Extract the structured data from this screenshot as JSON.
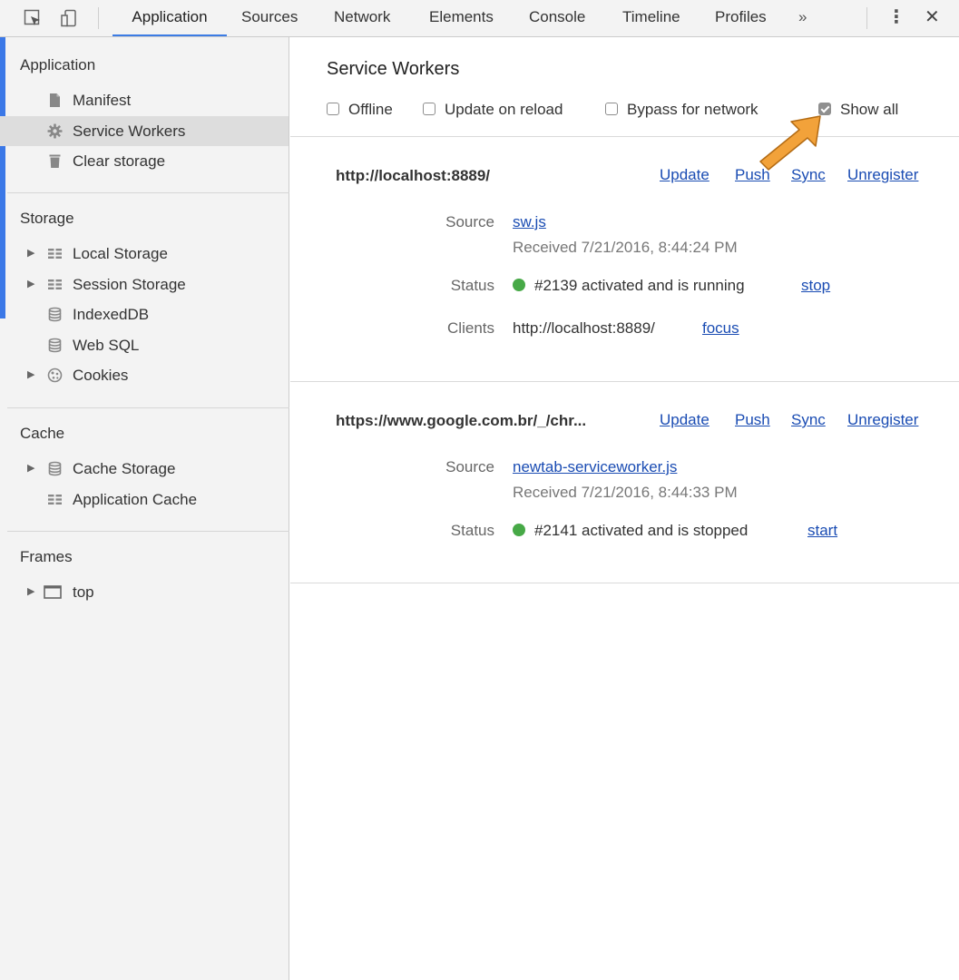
{
  "toolbar": {
    "tabs": [
      "Application",
      "Sources",
      "Network",
      "Elements",
      "Console",
      "Timeline",
      "Profiles"
    ],
    "more": "»",
    "menu": "⋮",
    "close": "✕",
    "accent": "#3c7ce4"
  },
  "sidebar": {
    "application": {
      "title": "Application",
      "items": [
        "Manifest",
        "Service Workers",
        "Clear storage"
      ]
    },
    "storage": {
      "title": "Storage",
      "items": [
        "Local Storage",
        "Session Storage",
        "IndexedDB",
        "Web SQL",
        "Cookies"
      ]
    },
    "cache": {
      "title": "Cache",
      "items": [
        "Cache Storage",
        "Application Cache"
      ]
    },
    "frames": {
      "title": "Frames",
      "items": [
        "top"
      ]
    }
  },
  "main": {
    "title": "Service Workers",
    "options": [
      {
        "label": "Offline",
        "checked": false
      },
      {
        "label": "Update on reload",
        "checked": false
      },
      {
        "label": "Bypass for network",
        "checked": false
      },
      {
        "label": "Show all",
        "checked": true
      }
    ],
    "workers": [
      {
        "origin": "http://localhost:8889/",
        "actions": [
          "Update",
          "Push",
          "Sync",
          "Unregister"
        ],
        "source_label": "Source",
        "source": "sw.js",
        "received": "Received 7/21/2016, 8:44:24 PM",
        "status_label": "Status",
        "status": "#2139 activated and is running",
        "status_action": "stop",
        "clients_label": "Clients",
        "clients": "http://localhost:8889/",
        "clients_action": "focus"
      },
      {
        "origin": "https://www.google.com.br/_/chr...",
        "actions": [
          "Update",
          "Push",
          "Sync",
          "Unregister"
        ],
        "source_label": "Source",
        "source": "newtab-serviceworker.js",
        "received": "Received 7/21/2016, 8:44:33 PM",
        "status_label": "Status",
        "status": "#2141 activated and is stopped",
        "status_action": "start"
      }
    ],
    "status_color": "#47a947",
    "annotation_arrow_color": "#f2a23a"
  }
}
